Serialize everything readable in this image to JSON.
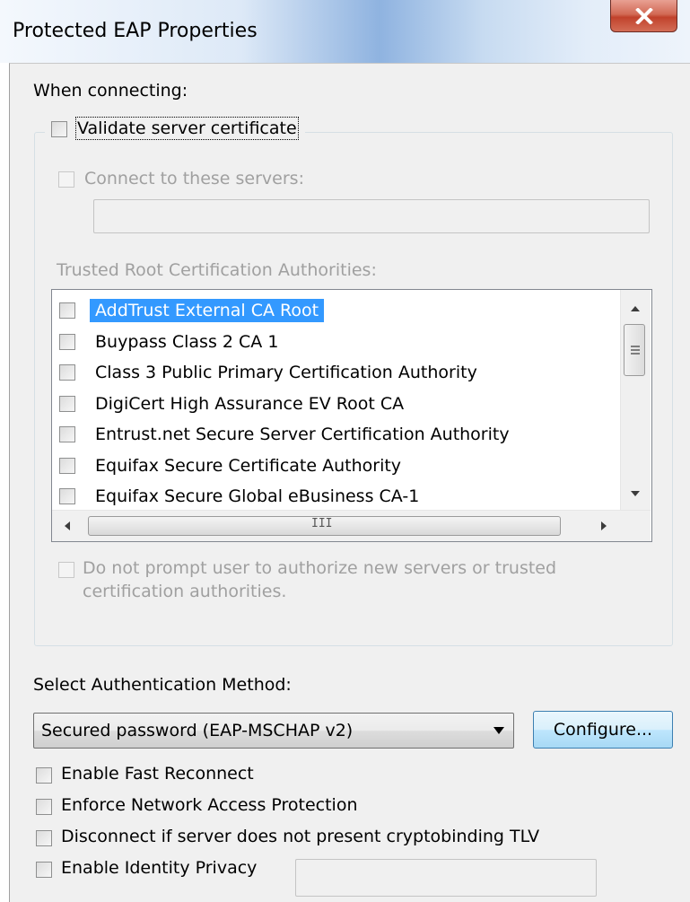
{
  "window": {
    "title": "Protected EAP Properties",
    "close_glyph": "X"
  },
  "dialog": {
    "when_connecting": "When connecting:",
    "validate_server_cert": {
      "label": "Validate server certificate",
      "checked": false
    },
    "connect_to_servers": {
      "label": "Connect to these servers:",
      "checked": false,
      "value": ""
    },
    "trusted_root_label": "Trusted Root Certification Authorities:",
    "trusted_roots": [
      {
        "label": "AddTrust External CA Root",
        "checked": false,
        "selected": true
      },
      {
        "label": "Buypass Class 2 CA 1",
        "checked": false,
        "selected": false
      },
      {
        "label": "Class 3 Public Primary Certification Authority",
        "checked": false,
        "selected": false
      },
      {
        "label": "DigiCert High Assurance EV Root CA",
        "checked": false,
        "selected": false
      },
      {
        "label": "Entrust.net Secure Server Certification Authority",
        "checked": false,
        "selected": false
      },
      {
        "label": "Equifax Secure Certificate Authority",
        "checked": false,
        "selected": false
      },
      {
        "label": "Equifax Secure Global eBusiness CA-1",
        "checked": false,
        "selected": false
      }
    ],
    "hscroll_grip": "III",
    "do_not_prompt": {
      "line1": "Do not prompt user to authorize new servers or trusted",
      "line2": "certification authorities.",
      "checked": false
    },
    "auth_method_label": "Select Authentication Method:",
    "auth_method_value": "Secured password (EAP-MSCHAP v2)",
    "configure_label": "Configure...",
    "options": [
      {
        "label": "Enable Fast Reconnect",
        "checked": false
      },
      {
        "label": "Enforce Network Access Protection",
        "checked": false
      },
      {
        "label": "Disconnect if server does not present cryptobinding TLV",
        "checked": false
      },
      {
        "label": "Enable Identity Privacy",
        "checked": false
      }
    ],
    "identity_privacy_value": ""
  },
  "colors": {
    "selection": "#3399ff",
    "close_button": "#c1422c",
    "disabled_text": "#a0a0a0"
  }
}
